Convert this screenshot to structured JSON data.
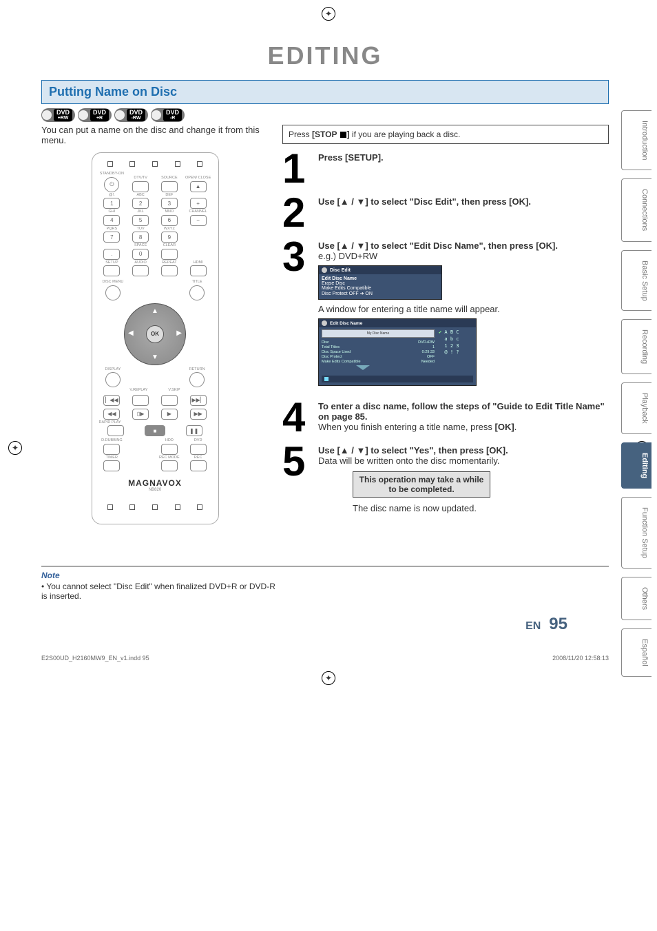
{
  "title": "EDITING",
  "section_header": "Putting Name on Disc",
  "disc_badges": [
    {
      "label": "DVD",
      "sub": "+RW"
    },
    {
      "label": "DVD",
      "sub": "+R"
    },
    {
      "label": "DVD",
      "sub": "-RW"
    },
    {
      "label": "DVD",
      "sub": "-R"
    }
  ],
  "intro_text": "You can put a name on the disc and change it from this menu.",
  "remote": {
    "row_labels_1": [
      "STANDBY-ON",
      "DTV/TV",
      "SOURCE",
      "OPEN/\nCLOSE"
    ],
    "row_labels_2": [
      "@!.",
      "ABC",
      "DEF",
      ""
    ],
    "row_num_1": [
      "1",
      "2",
      "3",
      "+"
    ],
    "row_labels_3": [
      "GHI",
      "JKL",
      "MNO",
      "CHANNEL"
    ],
    "row_num_2": [
      "4",
      "5",
      "6",
      "−"
    ],
    "row_labels_4": [
      "PQRS",
      "TUV",
      "WXYZ",
      ""
    ],
    "row_num_3": [
      "7",
      "8",
      "9",
      ""
    ],
    "row_labels_5": [
      "",
      "SPACE",
      "CLEAR",
      ""
    ],
    "row_num_4": [
      ".",
      "0",
      "",
      ""
    ],
    "row_labels_6": [
      "SETUP",
      "AUDIO",
      "REPEAT",
      "HDMI"
    ],
    "disc_menu": "DISC MENU",
    "title_btn": "TITLE",
    "ok": "OK",
    "display": "DISPLAY",
    "return": "RETURN",
    "vreplay": "V.REPLAY",
    "vskip": "V.SKIP",
    "rapid": "RAPID PLAY",
    "ddub": "D.DUBBING",
    "hdd": "HDD",
    "dvd": "DVD",
    "timer": "TIMER",
    "recmode": "REC MODE",
    "rec": "REC",
    "brand": "MAGNAVOX",
    "model": "NB820"
  },
  "instr_box_prefix": "Press ",
  "instr_box_bold": "[STOP ",
  "instr_box_suffix": "]",
  "instr_box_tail": " if you are playing back a disc.",
  "steps": {
    "1": {
      "headline": "Press [SETUP]."
    },
    "2": {
      "headline": "Use [▲ / ▼] to select \"Disc Edit\", then press [OK]."
    },
    "3": {
      "headline": "Use [▲ / ▼] to select \"Edit Disc Name\", then press [OK].",
      "sub": "e.g.) DVD+RW",
      "osd_title": "Disc Edit",
      "osd_items": [
        "Edit Disc Name",
        "Erase Disc",
        "Make Edits Compatible",
        "Disc Protect OFF ➔ ON"
      ],
      "after": "A window for entering a title name will appear.",
      "osd2_title": "Edit Disc Name",
      "osd2_placeholder": "My Disc Name",
      "osd2_rows": {
        "Disc": "DVD+RW",
        "Total Titles": "1",
        "Disc Space Used": "0:29:33",
        "Disc Protect": "OFF",
        "Make Edits Compatible": "Needed"
      },
      "charset_rows": [
        "✔ A B C",
        "  a b c",
        "  1 2 3",
        "  @ ! ?"
      ]
    },
    "4": {
      "headline": "To enter a disc name, follow the steps of \"Guide to Edit Title Name\" on page 85.",
      "sub1": "When you finish entering a title name, press ",
      "sub2": "[OK]",
      "sub3": "."
    },
    "5": {
      "headline": "Use [▲ / ▼] to select \"Yes\", then press [OK].",
      "sub": "Data will be written onto the disc momentarily.",
      "note": "This operation may take a while to be completed.",
      "after": "The disc name is now updated."
    }
  },
  "side_tabs": [
    "Introduction",
    "Connections",
    "Basic Setup",
    "Recording",
    "Playback",
    "Editing",
    "Function Setup",
    "Others",
    "Español"
  ],
  "active_tab": "Editing",
  "note_heading": "Note",
  "note_bullet": "• You cannot select \"Disc Edit\" when finalized DVD+R or DVD-R is inserted.",
  "page_en": "EN",
  "page_num": "95",
  "footer_left": "E2S00UD_H2160MW9_EN_v1.indd   95",
  "footer_right": "2008/11/20   12:58:13"
}
